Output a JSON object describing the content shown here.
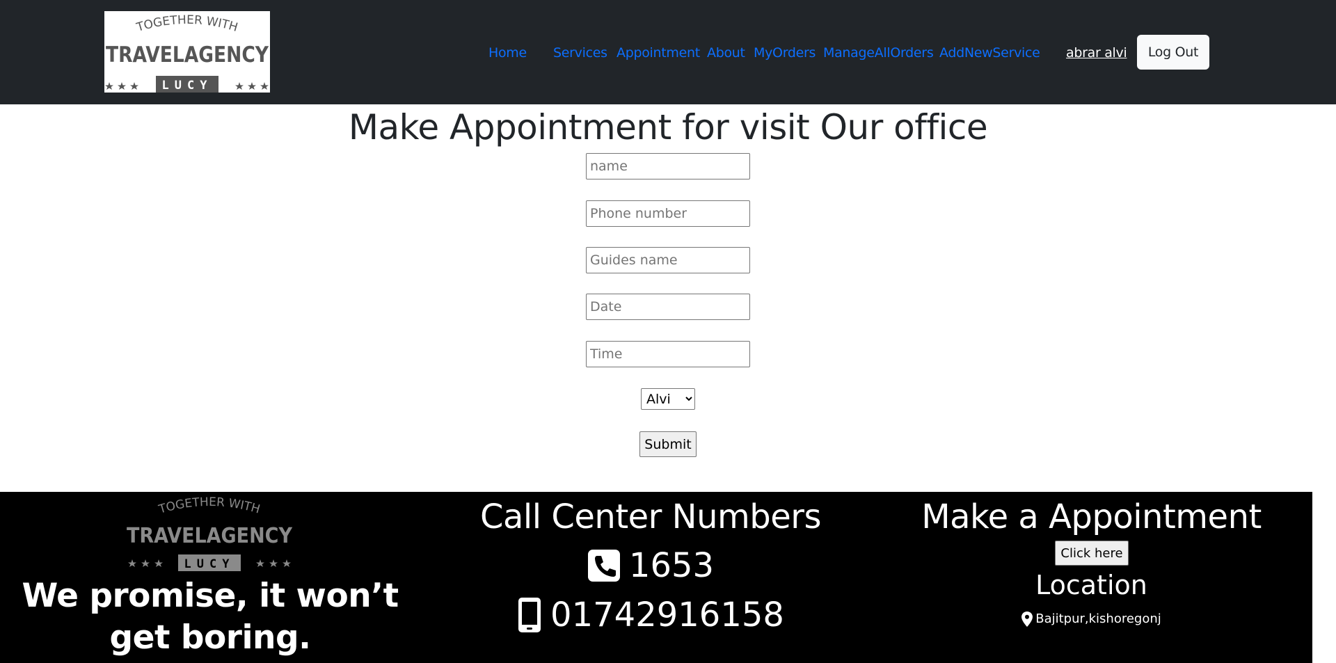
{
  "navbar": {
    "logo": {
      "top_text": "TOGETHER WITH",
      "main_text": "TRAVELAGENCY",
      "sub_text": "LUCY",
      "icon": "travelagency-logo"
    },
    "links": [
      {
        "label": "Home"
      },
      {
        "label": "Services"
      },
      {
        "label": "Appointment"
      },
      {
        "label": "About"
      },
      {
        "label": "MyOrders"
      },
      {
        "label": "ManageAllOrders"
      },
      {
        "label": "AddNewService"
      }
    ],
    "user_name": "abrar alvi",
    "logout_label": "Log Out",
    "colors": {
      "background": "#212529",
      "link": "#0d6efd"
    }
  },
  "main": {
    "title": "Make Appointment for visit Our office",
    "form": {
      "name_placeholder": "name",
      "phone_placeholder": "Phone number",
      "guide_placeholder": "Guides name",
      "date_placeholder": "Date",
      "time_placeholder": "Time",
      "select_value": "Alvi",
      "submit_label": "Submit"
    }
  },
  "footer": {
    "logo": {
      "top_text": "TOGETHER WITH",
      "main_text": "TRAVELAGENCY",
      "sub_text": "LUCY",
      "icon": "travelagency-logo"
    },
    "promise_text": "We promise, it won’t get boring.",
    "call_center_title": "Call Center Numbers",
    "phones": [
      {
        "icon": "phone-icon",
        "number": "1653"
      },
      {
        "icon": "mobile-phone-icon",
        "number": "01742916158"
      }
    ],
    "appointment_title": "Make a Appointment",
    "click_label": "Click here",
    "location_title": "Location",
    "location_icon": "map-pin-icon",
    "location_text": "Bajitpur,kishoregonj",
    "colors": {
      "background": "#000000"
    }
  }
}
